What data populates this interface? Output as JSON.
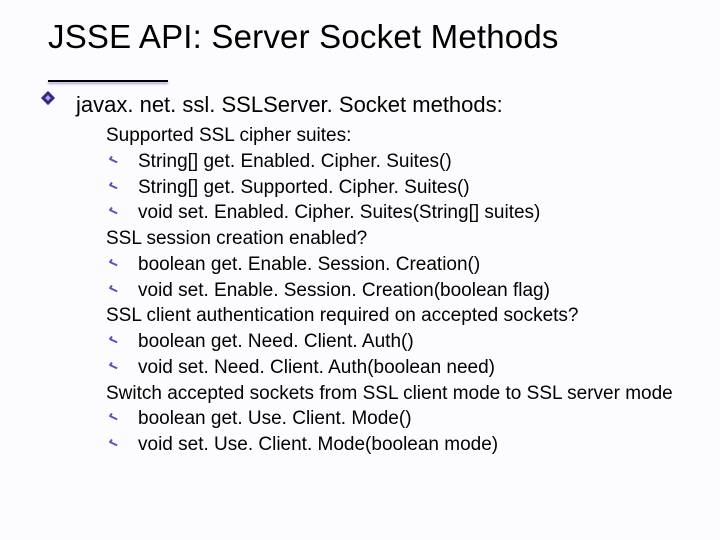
{
  "title": "JSSE API: Server Socket Methods",
  "main_point": "javax. net. ssl. SSLServer. Socket methods:",
  "groups": [
    {
      "heading": "Supported SSL cipher suites:",
      "items": [
        "String[] get. Enabled. Cipher. Suites()",
        "String[] get. Supported. Cipher. Suites()",
        "void set. Enabled. Cipher. Suites(String[] suites)"
      ]
    },
    {
      "heading": "SSL session creation enabled?",
      "items": [
        "boolean get. Enable. Session. Creation()",
        "void set. Enable. Session. Creation(boolean flag)"
      ]
    },
    {
      "heading": "SSL client authentication required on accepted sockets?",
      "items": [
        "boolean get. Need. Client. Auth()",
        "void set. Need. Client. Auth(boolean need)"
      ]
    },
    {
      "heading": "Switch accepted sockets from SSL client mode to SSL server mode",
      "items": [
        "boolean get. Use. Client. Mode()",
        "void set. Use. Client. Mode(boolean mode)"
      ]
    }
  ]
}
